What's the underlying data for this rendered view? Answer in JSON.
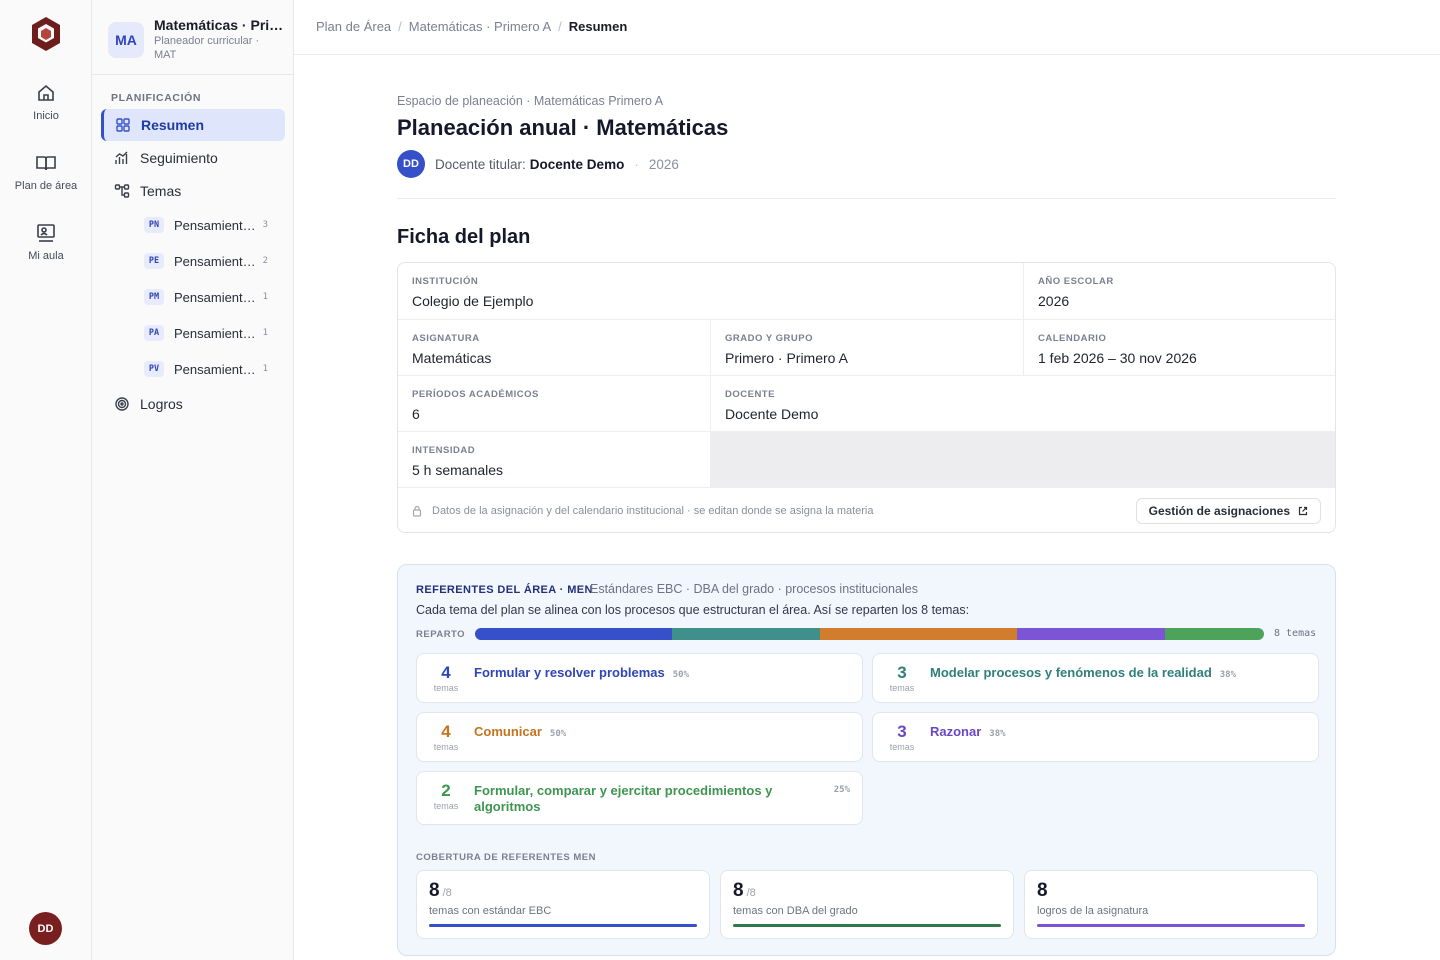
{
  "rail": {
    "items": [
      {
        "label": "Inicio",
        "icon": "home-icon"
      },
      {
        "label": "Plan de área",
        "icon": "book-icon"
      },
      {
        "label": "Mi aula",
        "icon": "classroom-icon"
      }
    ],
    "avatar": "DD"
  },
  "sidebar": {
    "badge": "MA",
    "title": "Matemáticas · Primero A",
    "subtitle": "Planeador curricular · MAT",
    "section": "PLANIFICACIÓN",
    "nav": [
      {
        "label": "Resumen",
        "icon": "grid-icon",
        "active": true
      },
      {
        "label": "Seguimiento",
        "icon": "chart-icon"
      },
      {
        "label": "Temas",
        "icon": "tree-icon"
      }
    ],
    "topics": [
      {
        "code": "PN",
        "name": "Pensamiento numérico",
        "count": "3"
      },
      {
        "code": "PE",
        "name": "Pensamiento espacial",
        "count": "2"
      },
      {
        "code": "PM",
        "name": "Pensamiento métrico",
        "count": "1"
      },
      {
        "code": "PA",
        "name": "Pensamiento aleatorio",
        "count": "1"
      },
      {
        "code": "PV",
        "name": "Pensamiento variacional",
        "count": "1"
      }
    ],
    "logros": "Logros"
  },
  "breadcrumb": {
    "items": [
      "Plan de Área",
      "Matemáticas · Primero A"
    ],
    "current": "Resumen"
  },
  "header": {
    "pretitle": "Espacio de planeación · Matemáticas Primero A",
    "title": "Planeación anual · Matemáticas",
    "avatar": "DD",
    "owner_label": "Docente titular:",
    "owner_name": "Docente Demo",
    "year": "2026"
  },
  "ficha": {
    "title": "Ficha del plan",
    "fields": {
      "institucion": {
        "label": "Institución",
        "value": "Colegio de Ejemplo"
      },
      "anio": {
        "label": "Año escolar",
        "value": "2026"
      },
      "asignatura": {
        "label": "Asignatura",
        "value": "Matemáticas"
      },
      "grado": {
        "label": "Grado y grupo",
        "value": "Primero · Primero A"
      },
      "calendario": {
        "label": "Calendario",
        "value": "1 feb 2026 – 30 nov 2026"
      },
      "periodos": {
        "label": "Períodos académicos",
        "value": "6"
      },
      "docente": {
        "label": "Docente",
        "value": "Docente Demo"
      },
      "intensidad": {
        "label": "Intensidad",
        "value": "5 h semanales"
      }
    },
    "footnote": "Datos de la asignación y del calendario institucional · se editan donde se asigna la materia",
    "button": "Gestión de asignaciones"
  },
  "referentes": {
    "title": "REFERENTES DEL ÁREA · MEN",
    "subtitle": "Estándares EBC · DBA del grado · procesos institucionales",
    "description": "Cada tema del plan se alinea con los procesos que estructuran el área. Así se reparten los 8 temas:",
    "reparto_label": "REPARTO",
    "reparto_total": "8 temas",
    "reparto": [
      {
        "color": "#3550c8",
        "weight": 4
      },
      {
        "color": "#3f8f8a",
        "weight": 3
      },
      {
        "color": "#d27c2e",
        "weight": 4
      },
      {
        "color": "#7c55d6",
        "weight": 3
      },
      {
        "color": "#4ea35a",
        "weight": 2
      }
    ],
    "units": "temas",
    "procesos": [
      {
        "count": "4",
        "name": "Formular y resolver problemas",
        "pct": "50%",
        "color": "#2f45b8"
      },
      {
        "count": "3",
        "name": "Modelar procesos y fenómenos de la realidad",
        "pct": "38%",
        "color": "#2f7f7a"
      },
      {
        "count": "4",
        "name": "Comunicar",
        "pct": "50%",
        "color": "#c6731f"
      },
      {
        "count": "3",
        "name": "Razonar",
        "pct": "38%",
        "color": "#6a47c4"
      },
      {
        "count": "2",
        "name": "Formular, comparar y ejercitar procedimientos y algoritmos",
        "pct": "25%",
        "color": "#3f9550"
      }
    ],
    "cobertura_label": "COBERTURA DE REFERENTES MEN",
    "cobertura": [
      {
        "value": "8",
        "denom": "/8",
        "label": "temas con estándar EBC",
        "color": "#3550c8"
      },
      {
        "value": "8",
        "denom": "/8",
        "label": "temas con DBA del grado",
        "color": "#2f7a4a"
      },
      {
        "value": "8",
        "denom": "",
        "label": "logros de la asignatura",
        "color": "#7c55d6"
      }
    ]
  }
}
